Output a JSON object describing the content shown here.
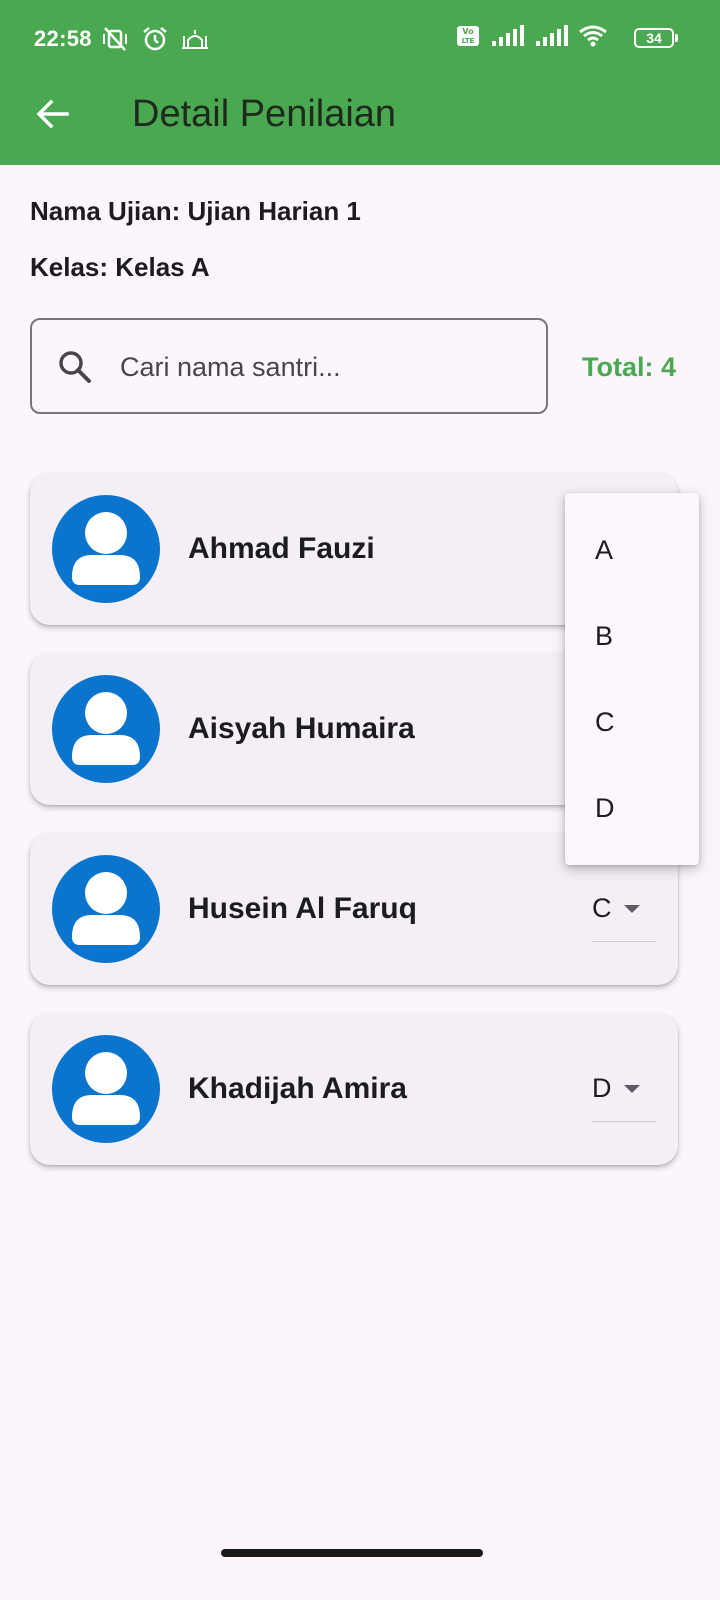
{
  "status_bar": {
    "time": "22:58",
    "battery": "34",
    "icons": [
      "mute-vibrate-icon",
      "alarm-icon",
      "mosque-icon",
      "volte-icon",
      "signal-icon",
      "signal-icon",
      "wifi-icon",
      "battery-icon"
    ]
  },
  "app_bar": {
    "title": "Detail Penilaian",
    "back_icon": "arrow-back-icon",
    "background": "#4aa851"
  },
  "info": {
    "exam_line": "Nama Ujian: Ujian Harian 1",
    "class_line": "Kelas: Kelas A"
  },
  "search": {
    "placeholder": "Cari nama santri...",
    "value": ""
  },
  "total_label": "Total: 4",
  "students": [
    {
      "name": "Ahmad Fauzi",
      "grade": ""
    },
    {
      "name": "Aisyah Humaira",
      "grade": ""
    },
    {
      "name": "Husein Al Faruq",
      "grade": "C"
    },
    {
      "name": "Khadijah Amira",
      "grade": "D"
    }
  ],
  "grade_menu": {
    "options": [
      "A",
      "B",
      "C",
      "D"
    ]
  },
  "colors": {
    "accent": "#4aa851",
    "avatar": "#0b74cd",
    "background": "#fcf6fc",
    "card": "#f4eff6"
  }
}
